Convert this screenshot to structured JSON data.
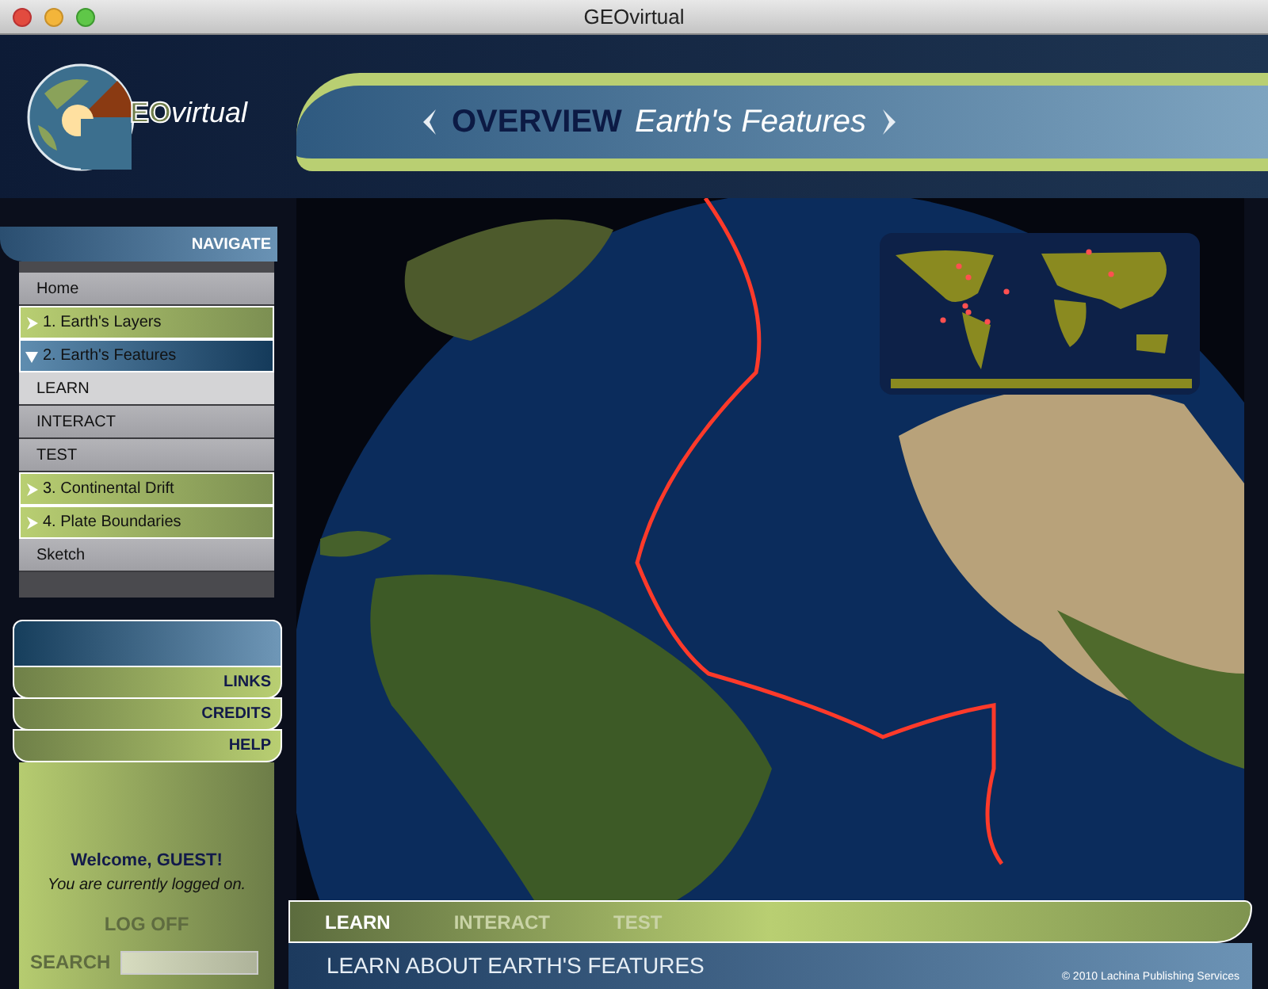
{
  "window": {
    "title": "GEOvirtual"
  },
  "logo": {
    "letters": "EO",
    "word": "virtual"
  },
  "header": {
    "title": "OVERVIEW",
    "subtitle": "Earth's Features"
  },
  "navigate": {
    "label": "NAVIGATE"
  },
  "nav_items": [
    {
      "label": "Home",
      "kind": "page",
      "selected": false
    },
    {
      "label": "1. Earth's Layers",
      "kind": "chapter",
      "expanded": false,
      "selected": false
    },
    {
      "label": "2. Earth's Features",
      "kind": "chapter",
      "expanded": true,
      "selected": true
    },
    {
      "label": "LEARN",
      "kind": "page",
      "selected": true
    },
    {
      "label": "INTERACT",
      "kind": "page",
      "selected": false
    },
    {
      "label": "TEST",
      "kind": "page",
      "selected": false
    },
    {
      "label": "3. Continental Drift",
      "kind": "chapter",
      "expanded": false,
      "selected": false
    },
    {
      "label": "4. Plate Boundaries",
      "kind": "chapter",
      "expanded": false,
      "selected": false
    },
    {
      "label": "Sketch",
      "kind": "page",
      "selected": false
    }
  ],
  "links": [
    "LINKS",
    "CREDITS",
    "HELP"
  ],
  "session": {
    "welcome": "Welcome, GUEST!",
    "status": "You are currently logged on.",
    "logoff": "LOG OFF",
    "search_label": "SEARCH"
  },
  "tabs": [
    {
      "label": "LEARN",
      "selected": true
    },
    {
      "label": "INTERACT",
      "selected": false
    },
    {
      "label": "TEST",
      "selected": false
    }
  ],
  "footer": {
    "caption": "LEARN ABOUT EARTH'S FEATURES",
    "copyright": "© 2010 Lachina Publishing Services"
  }
}
